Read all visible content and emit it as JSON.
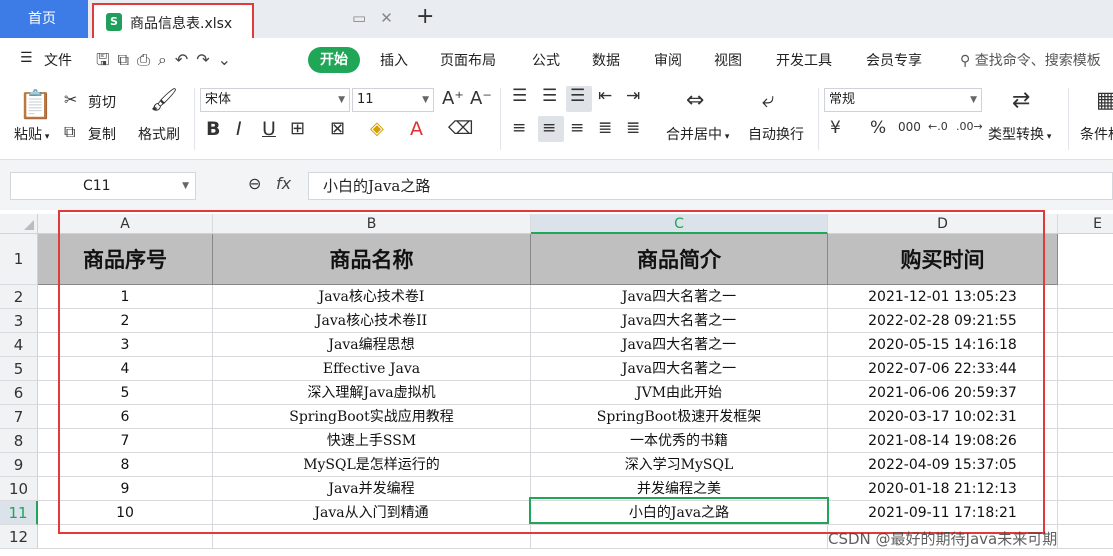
{
  "tabs": {
    "home_label": "首页",
    "doc_label": "商品信息表.xlsx",
    "doc_icon_letter": "S"
  },
  "menu": {
    "file_label": "文件",
    "start_label": "开始",
    "items": [
      "插入",
      "页面布局",
      "公式",
      "数据",
      "审阅",
      "视图",
      "开发工具",
      "会员专享"
    ],
    "search_placeholder": "查找命令、搜索模板"
  },
  "ribbon": {
    "paste_label": "粘贴",
    "cut_label": "剪切",
    "copy_label": "复制",
    "format_painter_label": "格式刷",
    "font_name": "宋体",
    "font_size": "11",
    "merge_label": "合并居中",
    "wrap_label": "自动换行",
    "number_format": "常规",
    "convert_label": "类型转换",
    "conditional_label": "条件格"
  },
  "formula_bar": {
    "cell_ref": "C11",
    "fx_label": "fx",
    "value": "小白的Java之路"
  },
  "sheet": {
    "columns": [
      "A",
      "B",
      "C",
      "D",
      "E"
    ],
    "rows": [
      "1",
      "2",
      "3",
      "4",
      "5",
      "6",
      "7",
      "8",
      "9",
      "10",
      "11",
      "12"
    ],
    "headers": [
      "商品序号",
      "商品名称",
      "商品简介",
      "购买时间"
    ],
    "data": [
      [
        "1",
        "Java核心技术卷I",
        "Java四大名著之一",
        "2021-12-01 13:05:23"
      ],
      [
        "2",
        "Java核心技术卷II",
        "Java四大名著之一",
        "2022-02-28 09:21:55"
      ],
      [
        "3",
        "Java编程思想",
        "Java四大名著之一",
        "2020-05-15 14:16:18"
      ],
      [
        "4",
        "Effective Java",
        "Java四大名著之一",
        "2022-07-06 22:33:44"
      ],
      [
        "5",
        "深入理解Java虚拟机",
        "JVM由此开始",
        "2021-06-06 20:59:37"
      ],
      [
        "6",
        "SpringBoot实战应用教程",
        "SpringBoot极速开发框架",
        "2020-03-17 10:02:31"
      ],
      [
        "7",
        "快速上手SSM",
        "一本优秀的书籍",
        "2021-08-14 19:08:26"
      ],
      [
        "8",
        "MySQL是怎样运行的",
        "深入学习MySQL",
        "2022-04-09 15:37:05"
      ],
      [
        "9",
        "Java并发编程",
        "并发编程之美",
        "2020-01-18 21:12:13"
      ],
      [
        "10",
        "Java从入门到精通",
        "小白的Java之路",
        "2021-09-11 17:18:21"
      ]
    ]
  },
  "watermark": "CSDN @最好的期待Java未来可期",
  "colors": {
    "accent_green": "#1fa657",
    "home_tab_blue": "#3d7be6",
    "highlight_red": "#e03a3a",
    "header_fill": "#bfbfbf"
  }
}
